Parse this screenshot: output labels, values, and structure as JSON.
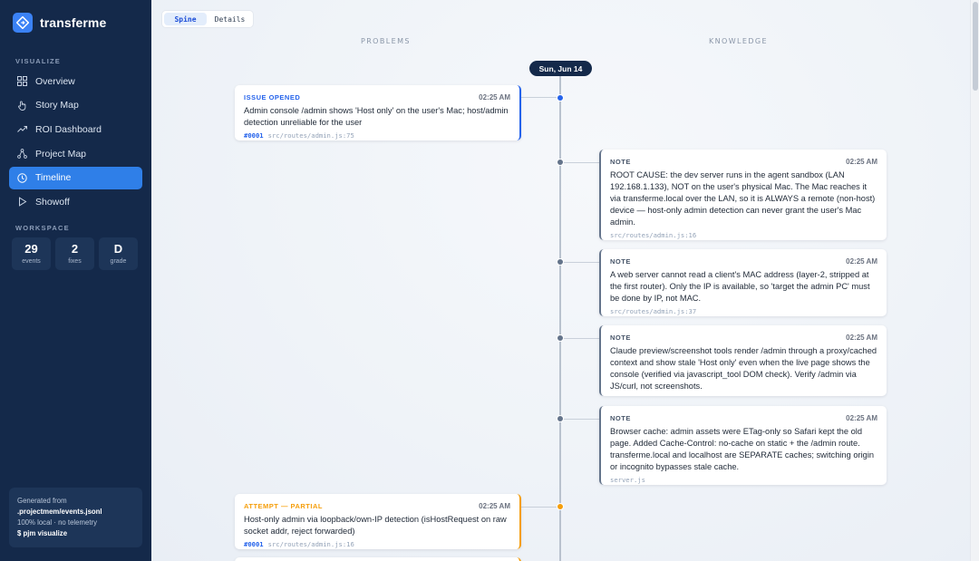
{
  "app": {
    "name": "transferme"
  },
  "sidebar": {
    "visualize_label": "VISUALIZE",
    "items": [
      {
        "label": "Overview",
        "icon": "grid-icon",
        "active": false
      },
      {
        "label": "Story Map",
        "icon": "hand-pointer-icon",
        "active": false
      },
      {
        "label": "ROI Dashboard",
        "icon": "trend-up-icon",
        "active": false
      },
      {
        "label": "Project Map",
        "icon": "nodes-icon",
        "active": false
      },
      {
        "label": "Timeline",
        "icon": "clock-icon",
        "active": true
      },
      {
        "label": "Showoff",
        "icon": "play-icon",
        "active": false
      }
    ],
    "workspace_label": "WORKSPACE",
    "stats": [
      {
        "value": "29",
        "label": "events"
      },
      {
        "value": "2",
        "label": "fixes"
      },
      {
        "value": "D",
        "label": "grade"
      }
    ],
    "generated": {
      "line1": "Generated from",
      "line2": ".projectmem/events.jsonl",
      "line3": "100% local · no telemetry",
      "line4": "$ pjm visualize"
    }
  },
  "toolbar": {
    "views": [
      {
        "label": "Spine",
        "active": true
      },
      {
        "label": "Details",
        "active": false
      }
    ]
  },
  "timeline": {
    "problems_header": "PROBLEMS",
    "knowledge_header": "KNOWLEDGE",
    "date": "Sun, Jun 14",
    "colors": {
      "issue": "#2563eb",
      "attempt_partial": "#f59e0b",
      "note": "#64748b"
    },
    "events": [
      {
        "type": "ISSUE OPENED",
        "time": "02:25 AM",
        "text": "Admin console /admin shows 'Host only' on the user's Mac; host/admin detection unreliable for the user",
        "ref": "#0001",
        "file": "src/routes/admin.js:75"
      },
      {
        "type": "NOTE",
        "time": "02:25 AM",
        "text": "ROOT CAUSE: the dev server runs in the agent sandbox (LAN 192.168.1.133), NOT on the user's physical Mac. The Mac reaches it via transferme.local over the LAN, so it is ALWAYS a remote (non-host) device — host-only admin detection can never grant the user's Mac admin.",
        "file": "src/routes/admin.js:16"
      },
      {
        "type": "NOTE",
        "time": "02:25 AM",
        "text": "A web server cannot read a client's MAC address (layer-2, stripped at the first router). Only the IP is available, so 'target the admin PC' must be done by IP, not MAC.",
        "file": "src/routes/admin.js:37"
      },
      {
        "type": "NOTE",
        "time": "02:25 AM",
        "text": "Claude preview/screenshot tools render /admin through a proxy/cached context and show stale 'Host only' even when the live page shows the console (verified via javascript_tool DOM check). Verify /admin via JS/curl, not screenshots.",
        "file": ""
      },
      {
        "type": "NOTE",
        "time": "02:25 AM",
        "text": "Browser cache: admin assets were ETag-only so Safari kept the old page. Added Cache-Control: no-cache on static + the /admin route. transferme.local and localhost are SEPARATE caches; switching origin or incognito bypasses stale cache.",
        "file": "server.js"
      },
      {
        "type": "ATTEMPT — PARTIAL",
        "time": "02:25 AM",
        "text": "Host-only admin via loopback/own-IP detection (isHostRequest on raw socket addr, reject forwarded)",
        "ref": "#0001",
        "file": "src/routes/admin.js:16"
      }
    ]
  }
}
